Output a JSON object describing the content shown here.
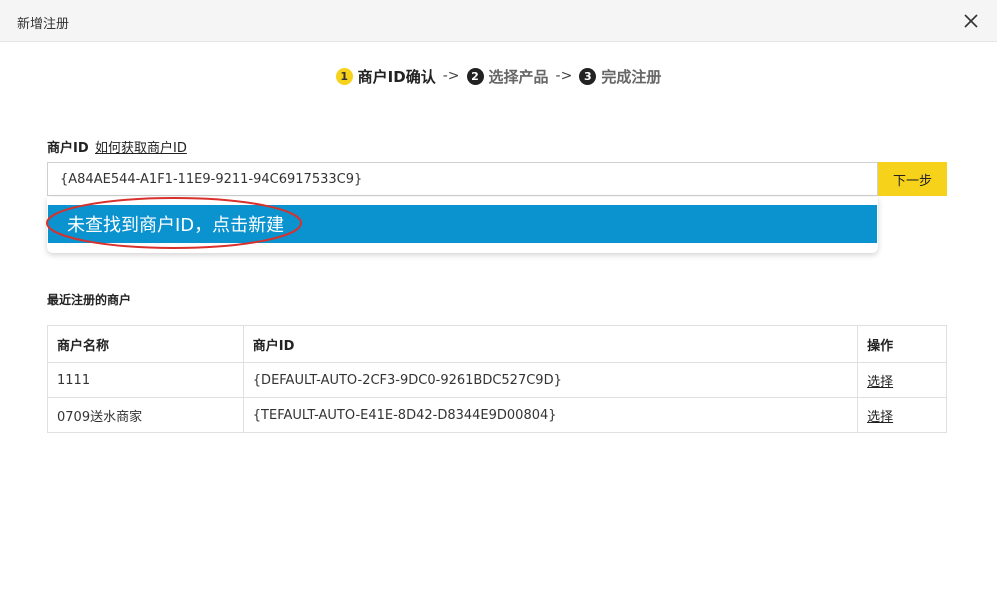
{
  "dialog": {
    "title": "新增注册",
    "close_icon": "close-icon"
  },
  "steps": [
    {
      "num": "1",
      "label": "商户ID确认",
      "active": true
    },
    {
      "num": "2",
      "label": "选择产品",
      "active": false
    },
    {
      "num": "3",
      "label": "完成注册",
      "active": false
    }
  ],
  "step_arrow": "->",
  "form": {
    "label": "商户ID",
    "help_link": "如何获取商户ID",
    "input_value": "{A84AE544-A1F1-11E9-9211-94C6917533C9}",
    "next_button": "下一步",
    "dropdown_item": "未查找到商户ID，点击新建"
  },
  "recent": {
    "title": "最近注册的商户",
    "headers": [
      "商户名称",
      "商户ID",
      "操作"
    ],
    "rows": [
      {
        "name": "1111",
        "id": "{DEFAULT-AUTO-2CF3-9DC0-9261BDC527C9D}",
        "action": "选择"
      },
      {
        "name": "0709送水商家",
        "id": "{TEFAULT-AUTO-E41E-8D42-D8344E9D00804}",
        "action": "选择"
      }
    ]
  },
  "colors": {
    "accent_yellow": "#f7d21a",
    "dropdown_blue": "#0a93cf",
    "annotation_red": "#d9302b"
  }
}
